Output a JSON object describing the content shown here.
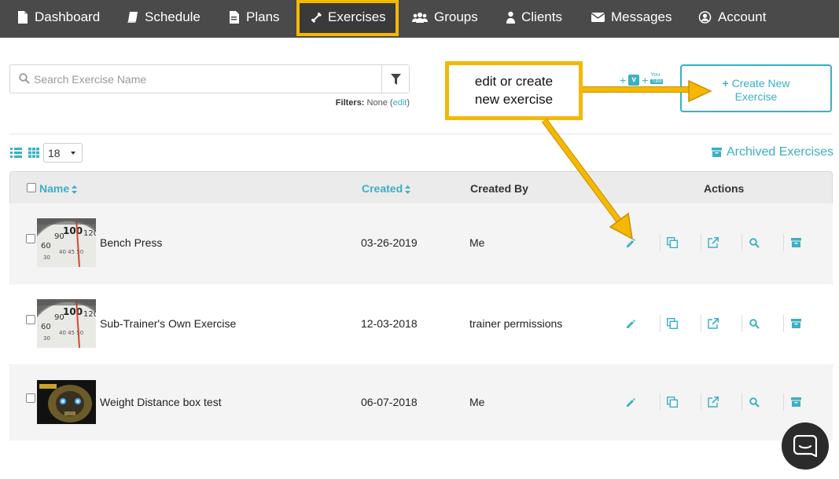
{
  "nav": {
    "items": [
      {
        "label": "Dashboard",
        "icon": "dashboard-icon"
      },
      {
        "label": "Schedule",
        "icon": "book-icon"
      },
      {
        "label": "Plans",
        "icon": "document-icon"
      },
      {
        "label": "Exercises",
        "icon": "dumbbell-icon",
        "active": true
      },
      {
        "label": "Groups",
        "icon": "users-icon"
      },
      {
        "label": "Clients",
        "icon": "user-icon"
      },
      {
        "label": "Messages",
        "icon": "envelope-icon"
      },
      {
        "label": "Account",
        "icon": "account-circle-icon"
      }
    ],
    "bg_color": "#4a4a4a",
    "highlight_color": "#f5b800"
  },
  "search": {
    "placeholder": "Search Exercise Name",
    "value": ""
  },
  "filters": {
    "label": "Filters:",
    "value": "None",
    "edit_label": "edit"
  },
  "media_links": {
    "plus1": "+",
    "vimeo": "v",
    "plus2": "+",
    "youtube_top": "You",
    "youtube_bottom": "Tube"
  },
  "create_button": {
    "plus": "+",
    "line1": "Create New",
    "line2": "Exercise"
  },
  "callout": {
    "line1": "edit or create",
    "line2": "new exercise"
  },
  "view": {
    "page_size": "18"
  },
  "archived_label": "Archived Exercises",
  "table": {
    "headers": {
      "name": "Name",
      "created": "Created",
      "created_by": "Created By",
      "actions": "Actions"
    },
    "rows": [
      {
        "name": "Bench Press",
        "created": "03-26-2019",
        "created_by": "Me",
        "thumb": "scale"
      },
      {
        "name": "Sub-Trainer's Own Exercise",
        "created": "12-03-2018",
        "created_by": "trainer permissions",
        "thumb": "scale"
      },
      {
        "name": "Weight Distance box test",
        "created": "06-07-2018",
        "created_by": "Me",
        "thumb": "robot"
      }
    ],
    "action_icons": [
      "pencil-icon",
      "copy-icon",
      "external-link-icon",
      "search-icon",
      "archive-icon"
    ]
  },
  "colors": {
    "accent": "#39b0c5",
    "callout_border": "#f5b800"
  }
}
